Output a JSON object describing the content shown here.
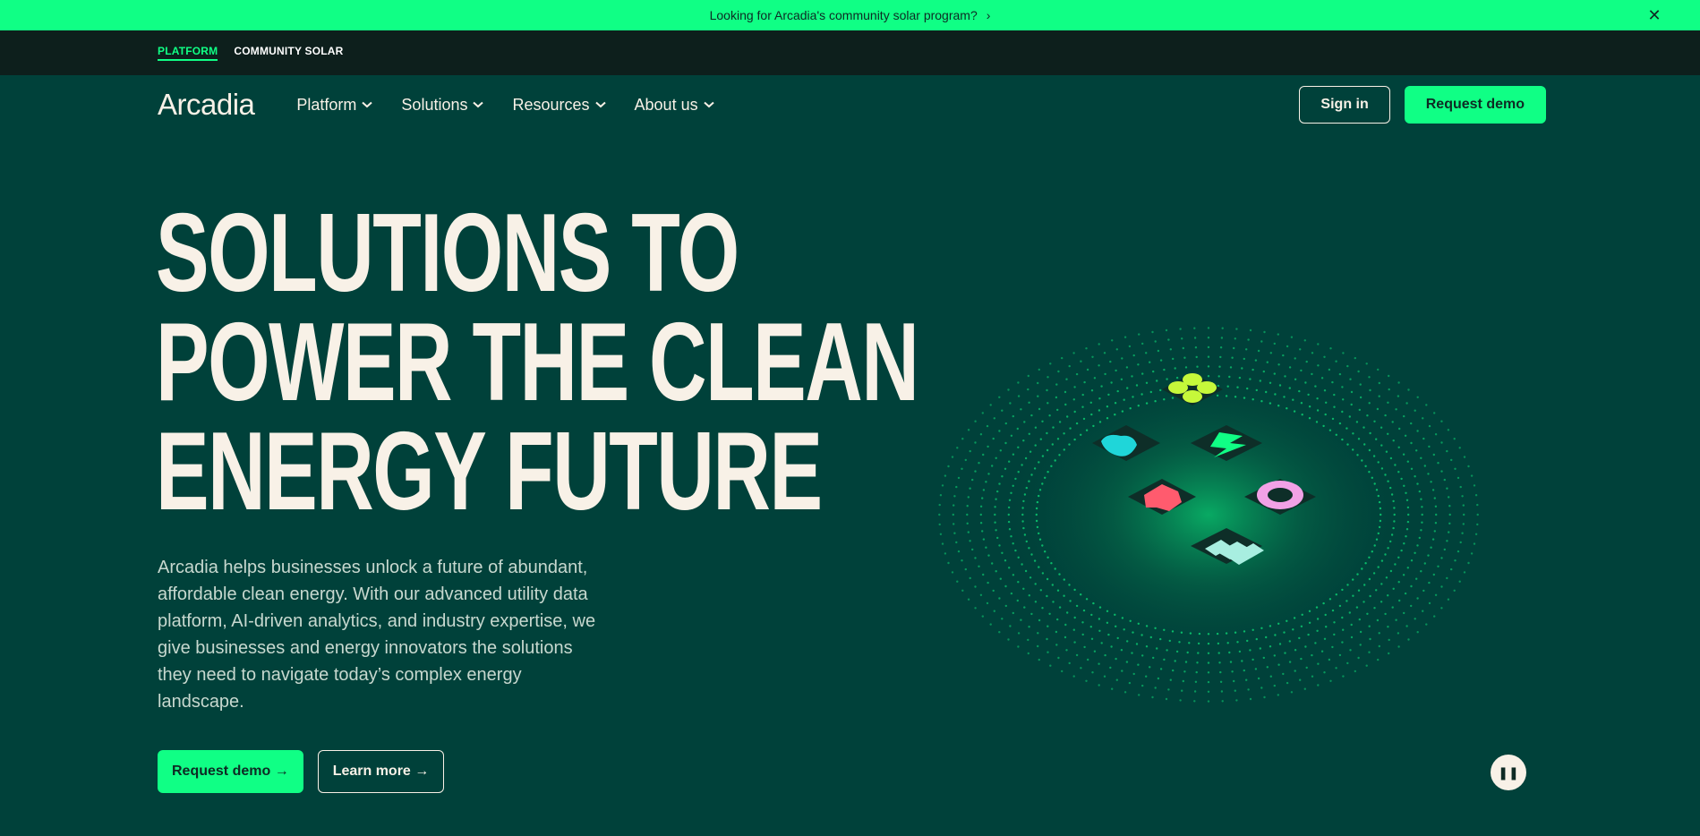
{
  "announcement": {
    "text": "Looking for Arcadia's community solar program?",
    "chevron": "›",
    "close": "✕"
  },
  "switcher": {
    "items": [
      {
        "label": "PLATFORM",
        "active": true
      },
      {
        "label": "COMMUNITY SOLAR",
        "active": false
      }
    ]
  },
  "nav": {
    "logo": "Arcadia",
    "items": [
      {
        "label": "Platform"
      },
      {
        "label": "Solutions"
      },
      {
        "label": "Resources"
      },
      {
        "label": "About us"
      }
    ],
    "caret": "⌄",
    "sign_in": "Sign in",
    "request_demo": "Request demo"
  },
  "hero": {
    "title_lines": [
      "SOLUTIONS TO",
      "POWER THE CLEAN",
      "ENERGY FUTURE"
    ],
    "description": "Arcadia helps businesses unlock a future of abundant, affordable clean energy. With our advanced utility data platform, AI-driven analytics, and industry expertise, we give businesses and energy innovators the solutions they need to navigate today’s complex energy landscape.",
    "cta_primary": "Request demo →",
    "cta_secondary": "Learn more →"
  },
  "media": {
    "pause_icon": "❚❚"
  },
  "colors": {
    "background": "#00413a",
    "accent": "#10ff85",
    "cream": "#f8f1e7",
    "dark_bar": "#0d1f1c"
  }
}
